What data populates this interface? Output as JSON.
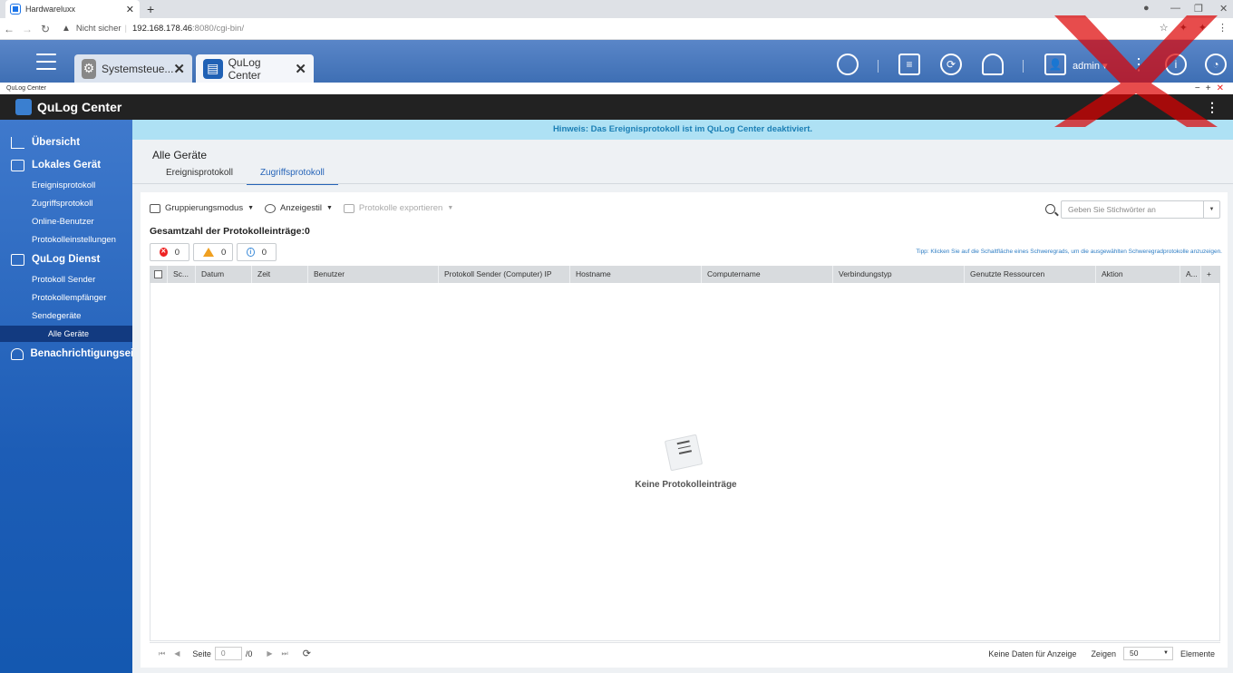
{
  "browser": {
    "tab_title": "Hardwareluxx",
    "address_warning": "Nicht sicher",
    "url_host": "192.168.178.46",
    "url_rest": ":8080/cgi-bin/"
  },
  "qts": {
    "tabs": [
      {
        "label": "Systemsteue..."
      },
      {
        "label": "QuLog Center"
      }
    ],
    "user_label": "admin ▾"
  },
  "app": {
    "window_title": "QuLog Center",
    "name": "QuLog Center"
  },
  "sidebar": {
    "overview": "Übersicht",
    "local_device": "Lokales Gerät",
    "local_items": [
      "Ereignisprotokoll",
      "Zugriffsprotokoll",
      "Online-Benutzer",
      "Protokolleinstellungen"
    ],
    "service": "QuLog Dienst",
    "service_items": [
      "Protokoll Sender",
      "Protokollempfänger",
      "Sendegeräte"
    ],
    "active_item": "Alle Geräte",
    "notifications": "Benachrichtigungseins"
  },
  "notice": "Hinweis: Das Ereignisprotokoll ist im QuLog Center deaktiviert.",
  "page": {
    "title": "Alle Geräte",
    "tabs": [
      "Ereignisprotokoll",
      "Zugriffsprotokoll"
    ],
    "active_tab": 1
  },
  "toolbar": {
    "grouping": "Gruppierungsmodus",
    "display_style": "Anzeigestil",
    "export": "Protokolle exportieren",
    "search_placeholder": "Geben Sie Stichwörter an"
  },
  "summary": {
    "total": "Gesamtzahl der Protokolleinträge:0",
    "errors": "0",
    "warnings": "0",
    "info": "0",
    "tip": "Tipp: Klicken Sie auf die Schaltfläche eines Schweregrads, um die ausgewählten Schweregradprotokolle anzuzeigen."
  },
  "table": {
    "columns": [
      "Sc...",
      "Datum",
      "Zeit",
      "Benutzer",
      "Protokoll Sender (Computer) IP",
      "Hostname",
      "Computername",
      "Verbindungstyp",
      "Genutzte Ressourcen",
      "Aktion",
      "A...",
      "+"
    ],
    "empty_text": "Keine Protokolleinträge"
  },
  "pager": {
    "page_label": "Seite",
    "page_value": "0",
    "page_total": "/0",
    "no_data": "Keine Daten für Anzeige",
    "show_label": "Zeigen",
    "page_size": "50",
    "items_label": "Elemente"
  },
  "colors": {
    "header_blue": "#3e6fb4",
    "sidebar_blue": "#1d5db6",
    "notice_bg": "#aee1f4",
    "accent": "#2664b8"
  }
}
